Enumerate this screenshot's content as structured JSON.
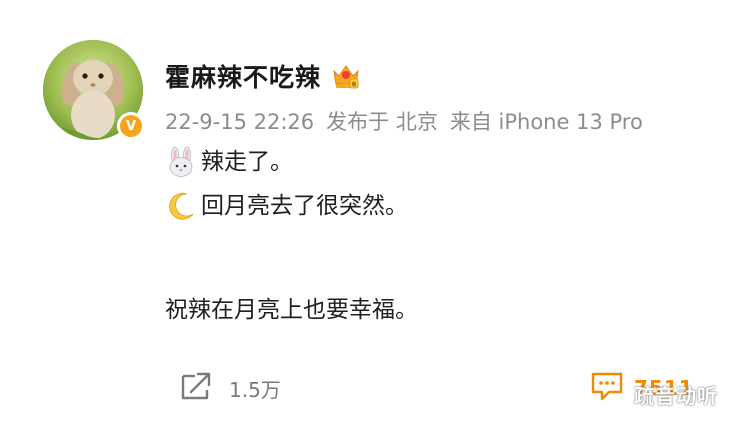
{
  "post": {
    "username": "霍麻辣不吃辣",
    "vip_icon": "crown-icon",
    "verified_badge_label": "V",
    "meta": {
      "time": "22-9-15 22:26",
      "location": "发布于 北京",
      "source": "来自 iPhone 13 Pro"
    },
    "content": {
      "line1_emoji": "rabbit-face-emoji",
      "line1_text": "辣走了。",
      "line2_emoji": "crescent-moon-emoji",
      "line2_text": "回月亮去了很突然。",
      "line3_text": "祝辣在月亮上也要幸福。"
    }
  },
  "actions": {
    "repost_count": "1.5万",
    "comment_count": "7511"
  },
  "watermark": "疏音动听",
  "colors": {
    "username": "#1a1a1a",
    "meta": "#8c8c8c",
    "verified": "#f3a51c",
    "comment_accent": "#f08a00",
    "action_gray": "#7a7a7a"
  }
}
